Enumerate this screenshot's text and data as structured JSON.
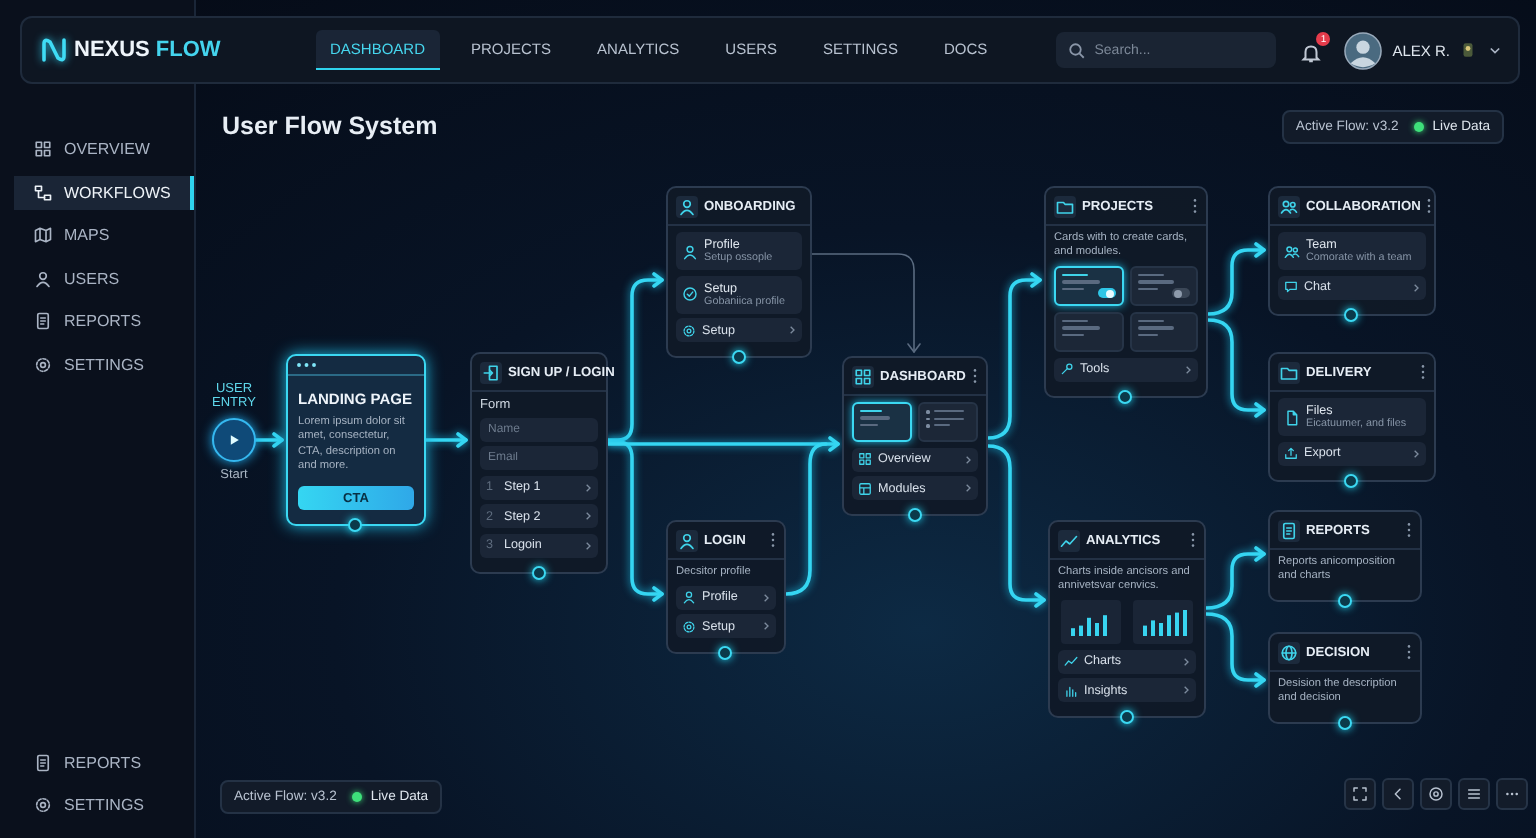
{
  "brand": {
    "name": "NEXUS",
    "accent": "FLOW"
  },
  "nav": [
    {
      "label": "DASHBOARD",
      "selected": true
    },
    {
      "label": "PROJECTS",
      "selected": false
    },
    {
      "label": "ANALYTICS",
      "selected": false
    },
    {
      "label": "USERS",
      "selected": false
    },
    {
      "label": "SETTINGS",
      "selected": false
    },
    {
      "label": "DOCS",
      "selected": false
    }
  ],
  "search": {
    "placeholder": "Search..."
  },
  "notifications": {
    "count": "1"
  },
  "user": {
    "name": "ALEX R."
  },
  "sidebar": {
    "items": [
      {
        "label": "OVERVIEW",
        "selected": false
      },
      {
        "label": "WORKFLOWS",
        "selected": true
      },
      {
        "label": "MAPS",
        "selected": false
      },
      {
        "label": "USERS",
        "selected": false
      },
      {
        "label": "REPORTS",
        "selected": false
      },
      {
        "label": "SETTINGS",
        "selected": false
      }
    ],
    "bottom_items": [
      {
        "label": "REPORTS"
      },
      {
        "label": "SETTINGS"
      }
    ]
  },
  "page": {
    "title": "User Flow System"
  },
  "status_top": {
    "version": "Active Flow: v3.2",
    "live": "Live Data"
  },
  "status_bottom": {
    "version": "Active Flow: v3.2",
    "live": "Live Data"
  },
  "entry": {
    "label": "USER ENTRY",
    "caption": "Start"
  },
  "nodes": [
    {
      "kind": "window",
      "title": "LANDING PAGE",
      "description": "Lorem ipsum dolor sit amet, consectetur, CTA, description on and more.",
      "button": "CTA"
    },
    {
      "kind": "card",
      "title": "SIGN UP / LOGIN",
      "menu": false,
      "items": [
        {
          "kind": "heading",
          "label": "Form"
        },
        {
          "kind": "field",
          "placeholder": "Name"
        },
        {
          "kind": "field",
          "placeholder": "Email"
        },
        {
          "kind": "row",
          "number": "1",
          "label": "Step 1"
        },
        {
          "kind": "row",
          "number": "2",
          "label": "Step 2"
        },
        {
          "kind": "row",
          "number": "3",
          "label": "Logoin"
        }
      ]
    },
    {
      "kind": "card",
      "title": "ONBOARDING",
      "menu": false,
      "items": [
        {
          "kind": "sub",
          "label": "Profile",
          "sublabel": "Setup ossople"
        },
        {
          "kind": "sub",
          "label": "Setup",
          "sublabel": "Gobaniica profile"
        },
        {
          "kind": "row",
          "label": "Setup"
        }
      ]
    },
    {
      "kind": "card",
      "title": "LOGIN",
      "menu": true,
      "items": [
        {
          "kind": "text",
          "label": "Decsitor profile"
        },
        {
          "kind": "row",
          "label": "Profile"
        },
        {
          "kind": "row",
          "label": "Setup"
        }
      ]
    },
    {
      "kind": "card",
      "title": "DASHBOARD",
      "menu": true,
      "items": [
        {
          "kind": "thumbs",
          "thumbs": [
            {
              "kind": "plain",
              "selected": true
            },
            {
              "kind": "list",
              "selected": false
            }
          ]
        },
        {
          "kind": "row",
          "label": "Overview"
        },
        {
          "kind": "row",
          "label": "Modules"
        }
      ]
    },
    {
      "kind": "card",
      "title": "PROJECTS",
      "menu": true,
      "items": [
        {
          "kind": "text",
          "label": "Cards with to create cards, and modules."
        },
        {
          "kind": "thumbs",
          "thumbs": [
            {
              "kind": "toggle",
              "selected": true,
              "on": true
            },
            {
              "kind": "toggle",
              "selected": false,
              "on": false
            },
            {
              "kind": "plain",
              "selected": false
            },
            {
              "kind": "plain",
              "selected": false
            }
          ]
        },
        {
          "kind": "row",
          "label": "Tools"
        }
      ]
    },
    {
      "kind": "card",
      "title": "COLLABORATION",
      "menu": true,
      "items": [
        {
          "kind": "sub",
          "label": "Team",
          "sublabel": "Comorate with a team"
        },
        {
          "kind": "row",
          "label": "Chat"
        }
      ]
    },
    {
      "kind": "card",
      "title": "DELIVERY",
      "menu": true,
      "items": [
        {
          "kind": "sub",
          "label": "Files",
          "sublabel": "Eicatuumer, and files"
        },
        {
          "kind": "row",
          "label": "Export"
        }
      ]
    },
    {
      "kind": "card",
      "title": "ANALYTICS",
      "menu": true,
      "items": [
        {
          "kind": "text",
          "label": "Charts inside ancisors and annivetsvar cenvics."
        },
        {
          "kind": "charts"
        },
        {
          "kind": "row",
          "label": "Charts"
        },
        {
          "kind": "row",
          "label": "Insights"
        }
      ]
    },
    {
      "kind": "card",
      "title": "REPORTS",
      "menu": true,
      "items": [
        {
          "kind": "text",
          "label": "Reports anicomposition and charts"
        }
      ]
    },
    {
      "kind": "card",
      "title": "DECISION",
      "menu": true,
      "items": [
        {
          "kind": "text",
          "label": "Desision the description and decision"
        }
      ]
    }
  ]
}
